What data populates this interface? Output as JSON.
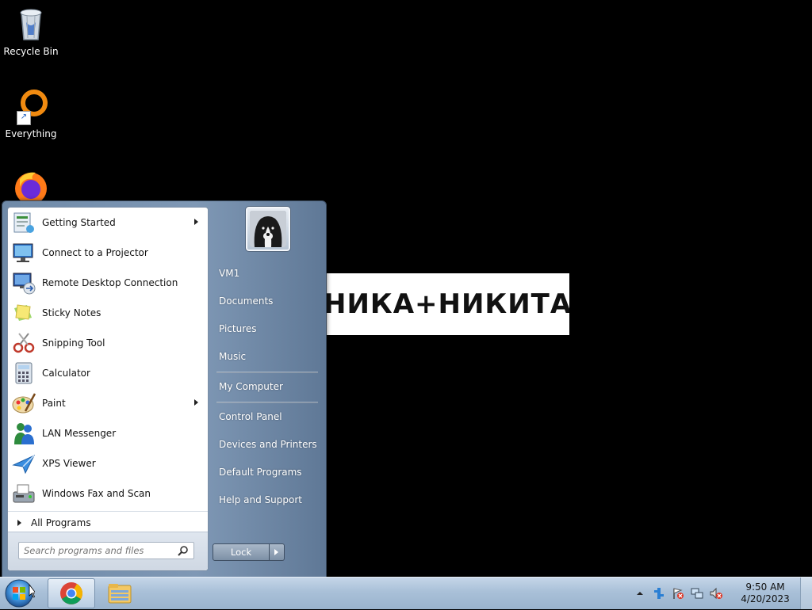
{
  "desktop": {
    "icons": [
      {
        "label": "Recycle Bin",
        "icon": "recycle-bin-icon"
      },
      {
        "label": "Everything",
        "icon": "everything-icon"
      },
      {
        "label": "",
        "icon": "firefox-icon"
      }
    ],
    "wallpaper_text": "НИКА+НИКИТА="
  },
  "start_menu": {
    "programs": [
      {
        "label": "Getting Started",
        "icon": "getting-started-icon",
        "has_submenu": true
      },
      {
        "label": "Connect to a Projector",
        "icon": "projector-icon",
        "has_submenu": false
      },
      {
        "label": "Remote Desktop Connection",
        "icon": "remote-desktop-icon",
        "has_submenu": false
      },
      {
        "label": "Sticky Notes",
        "icon": "sticky-notes-icon",
        "has_submenu": false
      },
      {
        "label": "Snipping Tool",
        "icon": "snipping-tool-icon",
        "has_submenu": false
      },
      {
        "label": "Calculator",
        "icon": "calculator-icon",
        "has_submenu": false
      },
      {
        "label": "Paint",
        "icon": "paint-icon",
        "has_submenu": true
      },
      {
        "label": "LAN Messenger",
        "icon": "lan-messenger-icon",
        "has_submenu": false
      },
      {
        "label": "XPS Viewer",
        "icon": "xps-viewer-icon",
        "has_submenu": false
      },
      {
        "label": "Windows Fax and Scan",
        "icon": "fax-scan-icon",
        "has_submenu": false
      }
    ],
    "all_programs": "All Programs",
    "search_placeholder": "Search programs and files",
    "right_items": {
      "user": "VM1",
      "documents": "Documents",
      "pictures": "Pictures",
      "music": "Music",
      "computer": "My Computer",
      "control_panel": "Control Panel",
      "devices": "Devices and Printers",
      "default_programs": "Default Programs",
      "help": "Help and Support"
    },
    "lock_label": "Lock"
  },
  "taskbar": {
    "pinned": [
      {
        "icon": "chrome-icon"
      },
      {
        "icon": "file-explorer-icon"
      }
    ],
    "tray_icons": [
      "show-hidden-icons-icon",
      "network-adapter-icon",
      "action-center-icon",
      "network-icon",
      "volume-muted-icon"
    ],
    "time": "9:50 AM",
    "date": "4/20/2023"
  },
  "colors": {
    "start_menu_blue": "#7f98b5",
    "taskbar_blue": "#a9c0d8",
    "heart_red": "#e11b22"
  }
}
